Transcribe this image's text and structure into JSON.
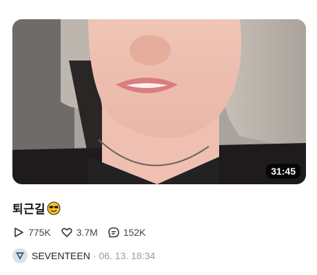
{
  "post": {
    "duration": "31:45",
    "title": "퇴근길",
    "title_emoji": "smiling-face-with-sunglasses-icon",
    "stats": {
      "plays": "775K",
      "likes": "3.7M",
      "comments": "152K"
    },
    "author": "SEVENTEEN",
    "separator": "·",
    "date": "06. 13. 18:34"
  },
  "colors": {
    "heart": "#ffffff",
    "muted": "#999999",
    "emoji_yellow": "#f7c325"
  }
}
